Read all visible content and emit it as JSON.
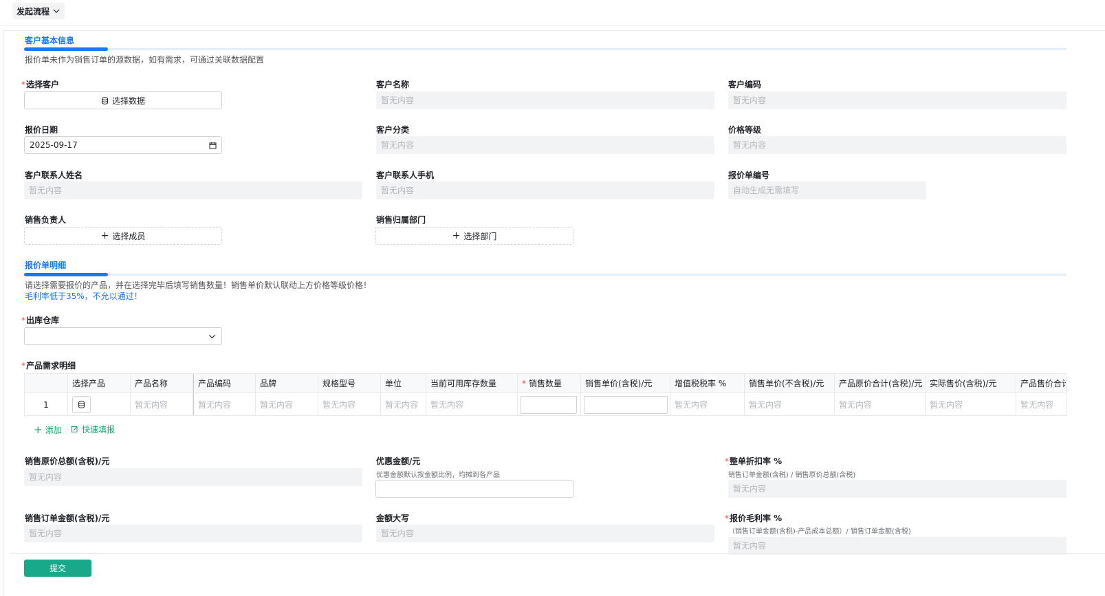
{
  "topbar": {
    "flow_label": "发起流程"
  },
  "section1": {
    "title": "客户基本信息",
    "desc": "报价单未作为销售订单的源数据，如有需求，可通过关联数据配置"
  },
  "fields": {
    "select_customer": {
      "label": "选择客户",
      "button": "选择数据"
    },
    "customer_name": {
      "label": "客户名称",
      "value": "暂无内容"
    },
    "customer_code": {
      "label": "客户编码",
      "value": "暂无内容"
    },
    "quote_date": {
      "label": "报价日期",
      "value": "2025-09-17"
    },
    "customer_category": {
      "label": "客户分类",
      "value": "暂无内容"
    },
    "price_level": {
      "label": "价格等级",
      "value": "暂无内容"
    },
    "contact_name": {
      "label": "客户联系人姓名",
      "value": "暂无内容"
    },
    "contact_phone": {
      "label": "客户联系人手机",
      "value": "暂无内容"
    },
    "quote_no": {
      "label": "报价单编号",
      "value": "自动生成无需填写"
    },
    "sales_owner": {
      "label": "销售负责人",
      "button": "选择成员"
    },
    "sales_dept": {
      "label": "销售归属部门",
      "button": "选择部门"
    }
  },
  "section2": {
    "title": "报价单明细",
    "desc1": "请选择需要报价的产品，并在选择完毕后填写销售数量！销售单价默认联动上方价格等级价格！",
    "desc2": "毛利率低于35%，不允以通过！"
  },
  "warehouse": {
    "label": "出库仓库",
    "value": ""
  },
  "product_detail": {
    "label": "产品需求明细",
    "columns": [
      "选择产品",
      "产品名称",
      "产品编码",
      "品牌",
      "规格型号",
      "单位",
      "当前可用库存数量",
      "销售数量",
      "销售单价(含税)/元",
      "增值税税率 %",
      "销售单价(不含税)/元",
      "产品原价合计(含税)/元",
      "实际售价(含税)/元",
      "产品售价合计"
    ],
    "row_index": "1",
    "empty": "暂无内容",
    "add_label": "添加",
    "quick_fill_label": "快速填报"
  },
  "totals": {
    "original_total": {
      "label": "销售原价总额(含税)/元",
      "value": "暂无内容"
    },
    "discount_amount": {
      "label": "优惠金额/元",
      "hint": "优惠金额默认按金额比例，均摊到各产品"
    },
    "discount_rate": {
      "label": "整单折扣率 %",
      "hint": "销售订单金额(含税) / 销售原价总额(含税)",
      "value": "暂无内容"
    },
    "order_amount": {
      "label": "销售订单金额(含税)/元",
      "value": "暂无内容"
    },
    "amount_upper": {
      "label": "金额大写",
      "value": "暂无内容"
    },
    "gross_margin": {
      "label": "报价毛利率 %",
      "hint": "（销售订单金额(含税)-产品成本总额）/ 销售订单金额(含税)",
      "value": "暂无内容"
    }
  },
  "submit_label": "提交",
  "colors": {
    "accent": "#1677ff",
    "submit": "#18a88a",
    "required": "#f54a45",
    "link_green": "#18a66b"
  }
}
